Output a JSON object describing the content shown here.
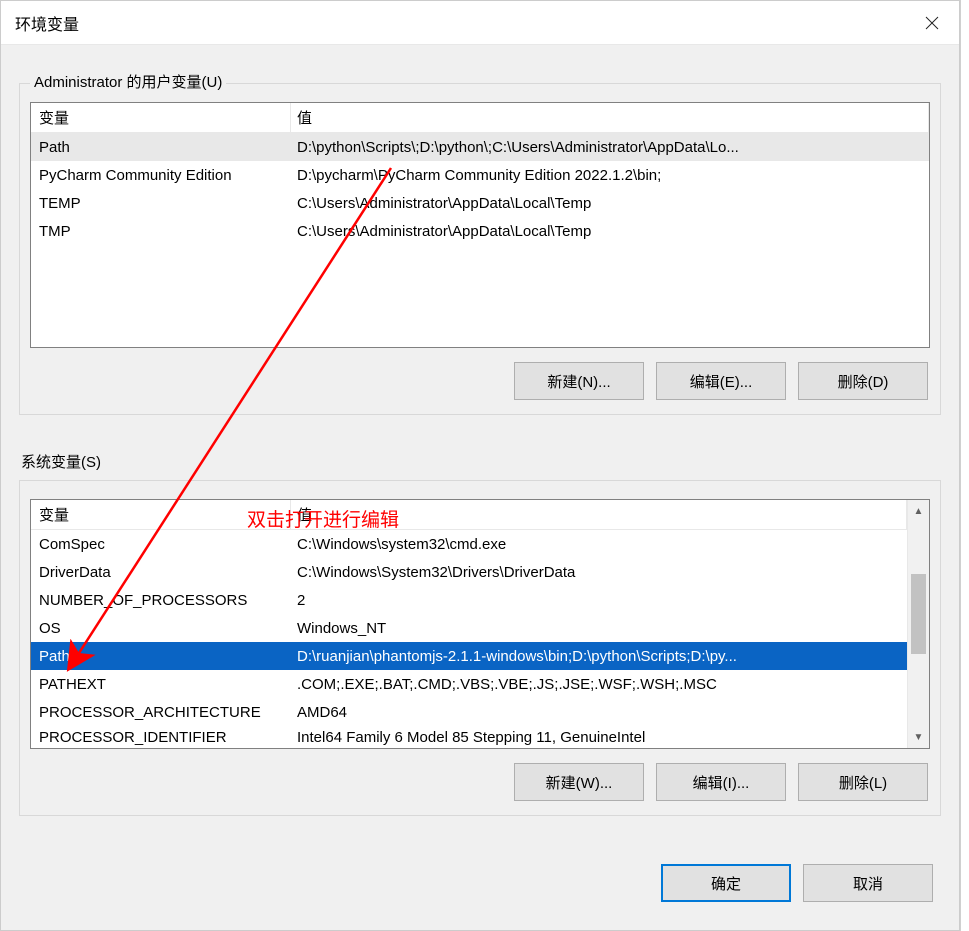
{
  "dialog": {
    "title": "环境变量"
  },
  "user_section": {
    "legend": "Administrator 的用户变量(U)",
    "header_var": "变量",
    "header_val": "值",
    "rows": [
      {
        "var": "Path",
        "val": "D:\\python\\Scripts\\;D:\\python\\;C:\\Users\\Administrator\\AppData\\Lo..."
      },
      {
        "var": "PyCharm Community Edition",
        "val": "D:\\pycharm\\PyCharm Community Edition 2022.1.2\\bin;"
      },
      {
        "var": "TEMP",
        "val": "C:\\Users\\Administrator\\AppData\\Local\\Temp"
      },
      {
        "var": "TMP",
        "val": "C:\\Users\\Administrator\\AppData\\Local\\Temp"
      }
    ],
    "buttons": {
      "new_": "新建(N)...",
      "edit": "编辑(E)...",
      "delete_": "删除(D)"
    }
  },
  "sys_section": {
    "legend": "系统变量(S)",
    "header_var": "变量",
    "header_val": "值",
    "rows": [
      {
        "var": "ComSpec",
        "val": "C:\\Windows\\system32\\cmd.exe"
      },
      {
        "var": "DriverData",
        "val": "C:\\Windows\\System32\\Drivers\\DriverData"
      },
      {
        "var": "NUMBER_OF_PROCESSORS",
        "val": "2"
      },
      {
        "var": "OS",
        "val": "Windows_NT"
      },
      {
        "var": "Path",
        "val": "D:\\ruanjian\\phantomjs-2.1.1-windows\\bin;D:\\python\\Scripts;D:\\py..."
      },
      {
        "var": "PATHEXT",
        "val": ".COM;.EXE;.BAT;.CMD;.VBS;.VBE;.JS;.JSE;.WSF;.WSH;.MSC"
      },
      {
        "var": "PROCESSOR_ARCHITECTURE",
        "val": "AMD64"
      },
      {
        "var": "PROCESSOR_IDENTIFIER",
        "val": "Intel64 Family 6 Model 85 Stepping 11, GenuineIntel"
      }
    ],
    "selected_index": 4,
    "buttons": {
      "new_": "新建(W)...",
      "edit": "编辑(I)...",
      "delete_": "删除(L)"
    }
  },
  "bottom": {
    "ok": "确定",
    "cancel": "取消"
  },
  "annotation": {
    "text": "双击打开进行编辑"
  }
}
